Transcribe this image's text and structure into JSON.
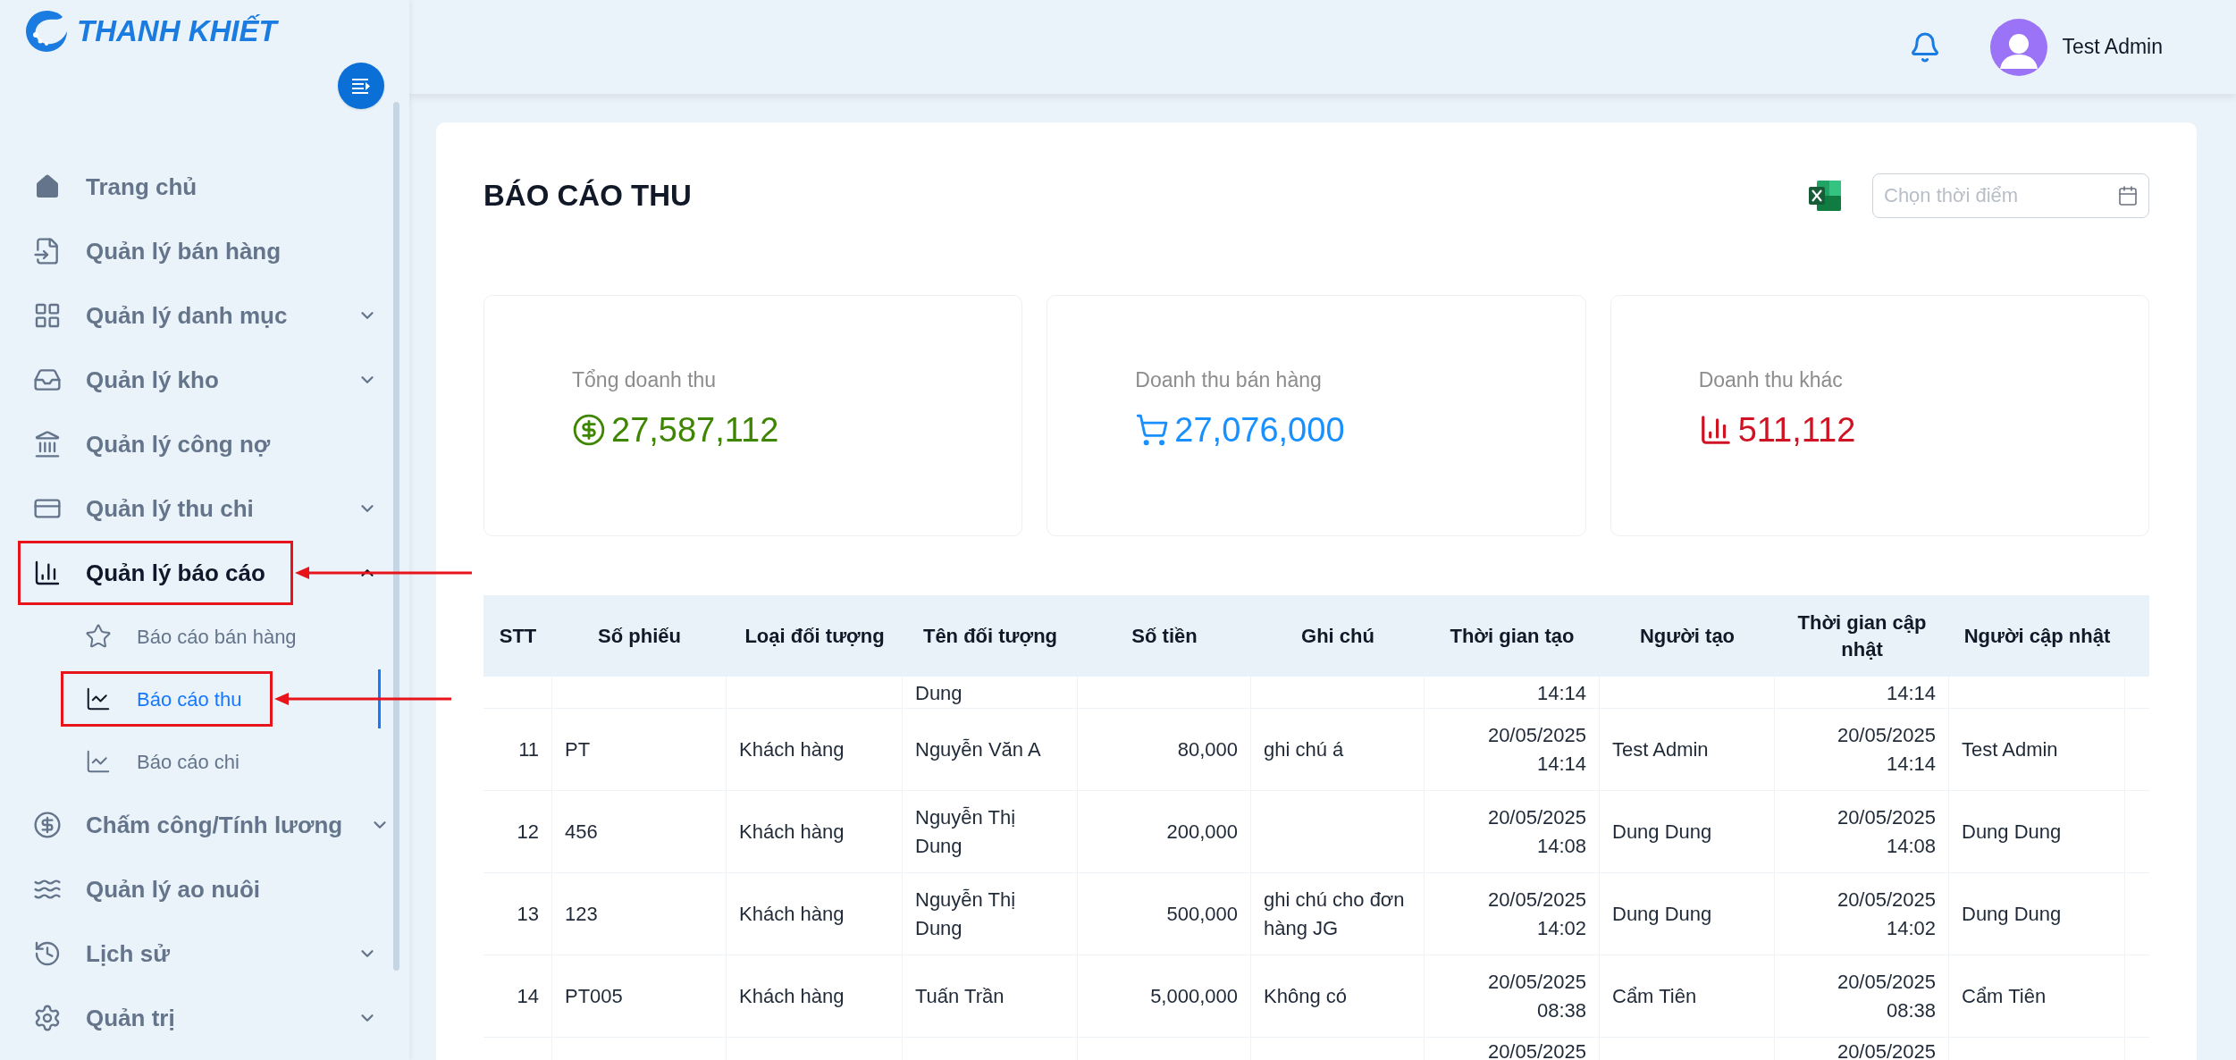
{
  "sidebar": {
    "logo_text": "THANH KHIẾT",
    "items": [
      {
        "label": "Trang chủ",
        "selected": false,
        "annotated": false
      },
      {
        "label": "Quản lý bán hàng",
        "selected": false,
        "annotated": false
      },
      {
        "label": "Quản lý danh mục",
        "selected": false,
        "annotated": false,
        "expanded": false
      },
      {
        "label": "Quản lý kho",
        "selected": false,
        "annotated": false,
        "expanded": false
      },
      {
        "label": "Quản lý công nợ",
        "selected": false,
        "annotated": false
      },
      {
        "label": "Quản lý thu chi",
        "selected": false,
        "annotated": false,
        "expanded": false
      },
      {
        "label": "Quản lý báo cáo",
        "selected": true,
        "annotated": true,
        "expanded": true,
        "children": [
          {
            "label": "Báo cáo bán hàng",
            "selected": false,
            "annotated": false
          },
          {
            "label": "Báo cáo thu",
            "selected": true,
            "annotated": true
          },
          {
            "label": "Báo cáo chi",
            "selected": false,
            "annotated": false
          }
        ]
      },
      {
        "label": "Chấm công/Tính lương",
        "selected": false,
        "annotated": false,
        "expanded": false
      },
      {
        "label": "Quản lý ao nuôi",
        "selected": false,
        "annotated": false
      },
      {
        "label": "Lịch sử",
        "selected": false,
        "annotated": false,
        "expanded": false
      },
      {
        "label": "Quản trị",
        "selected": false,
        "annotated": false,
        "expanded": false
      }
    ]
  },
  "header": {
    "user_name": "Test Admin"
  },
  "page": {
    "title": "BÁO CÁO THU",
    "date_picker": {
      "placeholder": "Chọn thời điểm"
    }
  },
  "stats": [
    {
      "kind": "dollar",
      "label": "Tổng doanh thu",
      "value": "27,587,112",
      "color": "#3f8600"
    },
    {
      "kind": "cart",
      "label": "Doanh thu bán hàng",
      "value": "27,076,000",
      "color": "#1890ff"
    },
    {
      "kind": "bars",
      "label": "Doanh thu khác",
      "value": "511,112",
      "color": "#cf1322"
    }
  ],
  "table": {
    "columns": [
      "STT",
      "Số phiếu",
      "Loại đối tượng",
      "Tên đối tượng",
      "Số tiền",
      "Ghi chú",
      "Thời gian tạo",
      "Người tạo",
      "Thời gian cập nhật",
      "Người cập nhật"
    ],
    "rows": [
      [
        null,
        null,
        null,
        "Dung",
        null,
        null,
        "14:14",
        null,
        "14:14",
        null
      ],
      [
        "11",
        "PT",
        "Khách hàng",
        "Nguyễn Văn A",
        "80,000",
        "ghi chú á",
        "20/05/2025 14:14",
        "Test Admin",
        "20/05/2025 14:14",
        "Test Admin"
      ],
      [
        "12",
        "456",
        "Khách hàng",
        "Nguyễn Thị Dung",
        "200,000",
        null,
        "20/05/2025 14:08",
        "Dung Dung",
        "20/05/2025 14:08",
        "Dung Dung"
      ],
      [
        "13",
        "123",
        "Khách hàng",
        "Nguyễn Thị Dung",
        "500,000",
        "ghi chú cho đơn hàng JG",
        "20/05/2025 14:02",
        "Dung Dung",
        "20/05/2025 14:02",
        "Dung Dung"
      ],
      [
        "14",
        "PT005",
        "Khách hàng",
        "Tuấn Trần",
        "5,000,000",
        "Không có",
        "20/05/2025 08:38",
        "Cẩm Tiên",
        "20/05/2025 08:38",
        "Cẩm Tiên"
      ],
      [
        null,
        null,
        null,
        null,
        null,
        null,
        "20/05/2025",
        null,
        "20/05/2025",
        null
      ]
    ]
  }
}
